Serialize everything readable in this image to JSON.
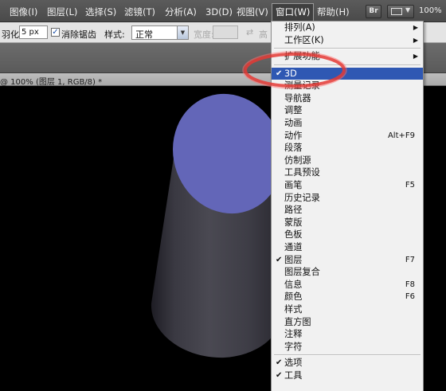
{
  "menubar": {
    "items": [
      {
        "label": "图像(I)"
      },
      {
        "label": "图层(L)"
      },
      {
        "label": "选择(S)"
      },
      {
        "label": "滤镜(T)"
      },
      {
        "label": "分析(A)"
      },
      {
        "label": "3D(D)"
      },
      {
        "label": "视图(V)"
      },
      {
        "label": "窗口(W)"
      },
      {
        "label": "帮助(H)"
      }
    ],
    "bridge_label": "Br",
    "zoom": "100%"
  },
  "options": {
    "feather_label": "羽化:",
    "feather_value": "5 px",
    "antialias_checked": true,
    "antialias_label": "消除锯齿",
    "style_label": "样式:",
    "style_value": "正常",
    "width_label": "宽度:",
    "height_label": "高"
  },
  "document": {
    "tab_title": "@ 100% (图层 1, RGB/8) *"
  },
  "canvas": {
    "object_top_color": "#6366b8",
    "object_side_color": "#3c3b45",
    "background_color": "#000000"
  },
  "window_menu": {
    "items": [
      {
        "label": "排列(A)",
        "submenu": true
      },
      {
        "label": "工作区(K)",
        "submenu": true
      },
      {
        "label": "扩展功能",
        "submenu": true
      },
      {
        "label": "3D",
        "checked": true,
        "highlighted": true
      },
      {
        "label": "测量记录"
      },
      {
        "label": "导航器"
      },
      {
        "label": "调整"
      },
      {
        "label": "动画"
      },
      {
        "label": "动作",
        "shortcut": "Alt+F9"
      },
      {
        "label": "段落"
      },
      {
        "label": "仿制源"
      },
      {
        "label": "工具预设"
      },
      {
        "label": "画笔",
        "shortcut": "F5"
      },
      {
        "label": "历史记录"
      },
      {
        "label": "路径"
      },
      {
        "label": "蒙版"
      },
      {
        "label": "色板"
      },
      {
        "label": "通道"
      },
      {
        "label": "图层",
        "checked": true,
        "shortcut": "F7"
      },
      {
        "label": "图层复合"
      },
      {
        "label": "信息",
        "shortcut": "F8"
      },
      {
        "label": "颜色",
        "shortcut": "F6"
      },
      {
        "label": "样式"
      },
      {
        "label": "直方图"
      },
      {
        "label": "注释"
      },
      {
        "label": "字符"
      },
      {
        "label": "选项",
        "checked": true
      },
      {
        "label": "工具",
        "checked": true
      }
    ],
    "highlight_color": "#2f58b3",
    "annotation_color": "#e53935"
  }
}
